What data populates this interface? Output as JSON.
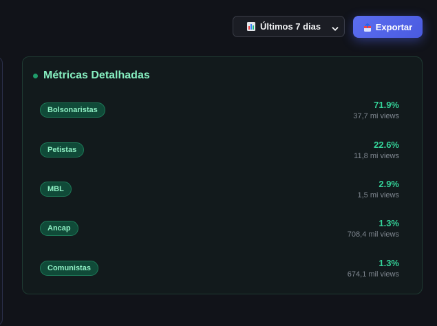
{
  "toolbar": {
    "period_select": {
      "icon": "calendar-chart-icon",
      "label": "Últimos 7 dias"
    },
    "export_button": {
      "icon": "export-icon",
      "label": "Exportar"
    }
  },
  "metrics_card": {
    "title": "Métricas Detalhadas",
    "rows": [
      {
        "tag": "Bolsonaristas",
        "percent": "71.9%",
        "views": "37,7 mi views"
      },
      {
        "tag": "Petistas",
        "percent": "22.6%",
        "views": "11,8 mi views"
      },
      {
        "tag": "MBL",
        "percent": "2.9%",
        "views": "1,5 mi views"
      },
      {
        "tag": "Ancap",
        "percent": "1.3%",
        "views": "708,4 mil views"
      },
      {
        "tag": "Comunistas",
        "percent": "1.3%",
        "views": "674,1 mil views"
      }
    ]
  },
  "colors": {
    "background": "#111319",
    "accent_green": "#34d399",
    "tag_bg": "#104a38",
    "export_blue": "#5b6ef0"
  }
}
